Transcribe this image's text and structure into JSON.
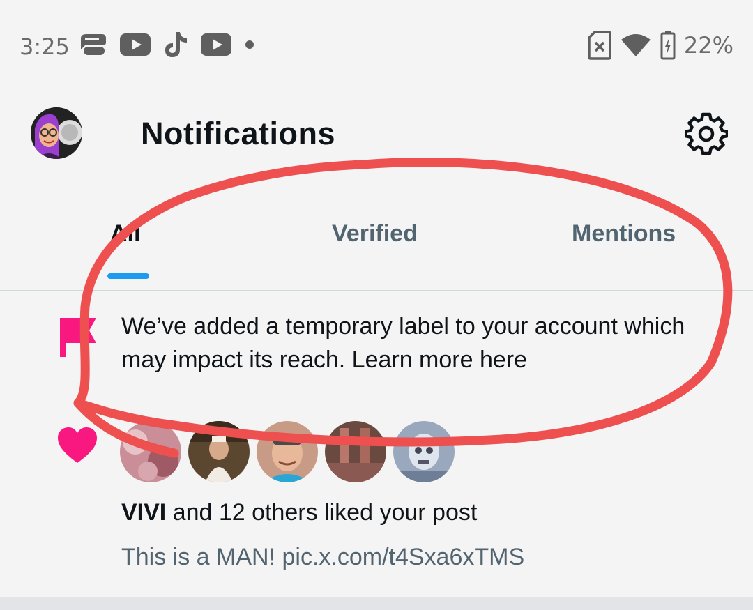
{
  "status_bar": {
    "time": "3:25",
    "left_icons": [
      "message-app-icon",
      "youtube-icon",
      "tiktok-icon",
      "youtube-icon",
      "dot-icon"
    ],
    "right_icons": [
      "no-sim-icon",
      "wifi-icon",
      "battery-charging-icon"
    ],
    "battery": "22%"
  },
  "header": {
    "title": "Notifications",
    "settings_icon": "gear-icon"
  },
  "tabs": [
    {
      "label": "All",
      "active": true
    },
    {
      "label": "Verified",
      "active": false
    },
    {
      "label": "Mentions",
      "active": false
    }
  ],
  "notice": {
    "icon": "flag-icon",
    "text": "We’ve added a temporary label to your account which may impact its reach. Learn more here"
  },
  "like_notification": {
    "icon": "heart-icon",
    "user": "VIVI",
    "rest": " and 12 others liked your post",
    "post_preview": "This is a MAN! pic.x.com/t4Sxa6xTMS"
  },
  "colors": {
    "accent": "#1d9bf0",
    "flag": "#f91880",
    "heart": "#f91880",
    "annotation": "#ee4f4f",
    "text_primary": "#0f1419",
    "text_secondary": "#536471"
  }
}
